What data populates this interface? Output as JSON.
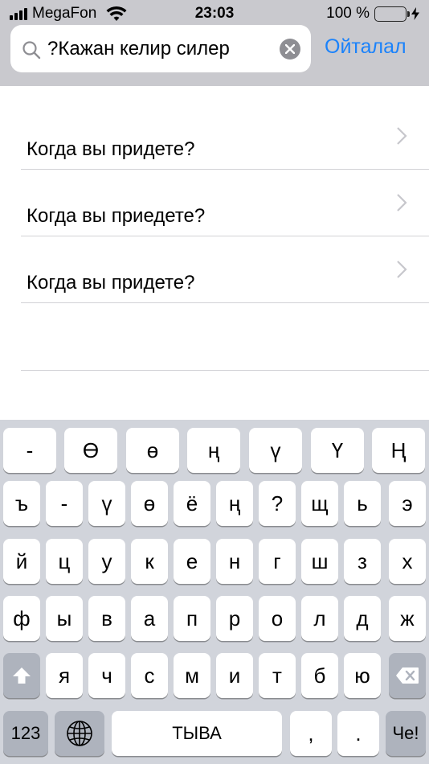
{
  "status_bar": {
    "carrier": "MegaFon",
    "time": "23:03",
    "battery_percent": "100 %"
  },
  "search": {
    "query": "Кажан келир силер?",
    "cancel_label": "Ойталал"
  },
  "results": [
    {
      "text": "Когда вы придете?"
    },
    {
      "text": "Когда вы приедете?"
    },
    {
      "text": "Когда вы придете?"
    }
  ],
  "keyboard": {
    "row1": [
      "-",
      "Ө",
      "ө",
      "ң",
      "ү",
      "Ү",
      "Ң"
    ],
    "row2": [
      "ъ",
      "-",
      "ү",
      "ө",
      "ё",
      "ң",
      "?",
      "щ",
      "ь",
      "э"
    ],
    "row3": [
      "й",
      "ц",
      "у",
      "к",
      "е",
      "н",
      "г",
      "ш",
      "з",
      "х"
    ],
    "row4": [
      "ф",
      "ы",
      "в",
      "а",
      "п",
      "р",
      "о",
      "л",
      "д",
      "ж"
    ],
    "row5": [
      "я",
      "ч",
      "с",
      "м",
      "и",
      "т",
      "б",
      "ю"
    ],
    "numbers_label": "123",
    "space_label": "ТЫВА",
    "comma_label": ",",
    "period_label": ".",
    "return_label": "Че!",
    "icons": {
      "shift": "shift-icon",
      "delete": "backspace-icon",
      "globe": "globe-icon"
    }
  },
  "colors": {
    "accent": "#1a82fb",
    "search_bar_bg": "#c9c9ce",
    "keyboard_bg": "#d1d4db",
    "battery": "#4cd964"
  }
}
